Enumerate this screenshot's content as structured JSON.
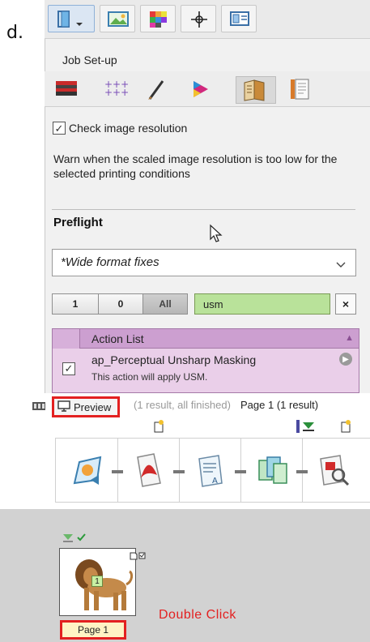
{
  "margin_fragment": "d.",
  "job_setup_title": "Job Set-up",
  "check_image_resolution": {
    "label": "Check image resolution",
    "checked": true,
    "description": "Warn when the scaled image resolution is too low for the selected printing conditions"
  },
  "preflight": {
    "heading": "Preflight",
    "selected_option": "*Wide format fixes"
  },
  "filter": {
    "buttons": [
      "1",
      "0",
      "All"
    ],
    "search_value": "usm",
    "clear_label": "×"
  },
  "action_list": {
    "header": "Action List",
    "items": [
      {
        "title": "ap_Perceptual Unsharp Masking",
        "description": "This action will apply USM.",
        "checked": true
      }
    ]
  },
  "status": {
    "preview_label": "Preview",
    "result_summary": "(1 result, all finished)",
    "page_summary": "Page 1 (1 result)"
  },
  "thumbnail": {
    "page_badge": "1",
    "page_label": "Page 1"
  },
  "annotation": "Double Click",
  "colors": {
    "highlight_red": "#e32020",
    "search_green": "#b9e29a",
    "action_purple": "#cc9fd0",
    "action_bg": "#eacfe9"
  },
  "icons": {
    "top_toolbar": [
      "document-dropdown-icon",
      "image-landscape-icon",
      "color-swatch-icon",
      "crosshair-icon",
      "layout-panel-icon"
    ],
    "job_setup_tabs": [
      "media-stack-icon",
      "grid-marks-icon",
      "brush-icon",
      "color-triangle-icon",
      "book-pages-icon",
      "page-icon"
    ],
    "workflow": [
      "image-input-icon",
      "pdf-icon",
      "text-document-icon",
      "pages-icon",
      "inspect-icon"
    ]
  }
}
